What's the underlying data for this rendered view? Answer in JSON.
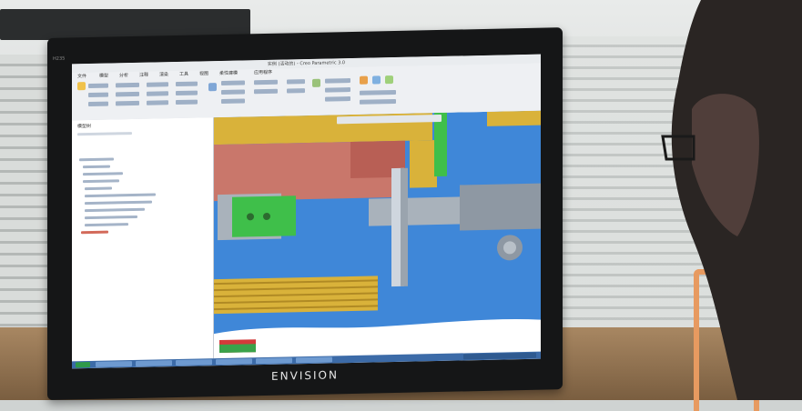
{
  "monitor": {
    "brand": "ENVISION",
    "model": "H235"
  },
  "app": {
    "title": "实例 (活动的) - Creo Parametric 3.0",
    "ribbon_tabs": [
      "文件",
      "模型",
      "分析",
      "注释",
      "渲染",
      "工具",
      "视图",
      "柔性建模",
      "应用程序"
    ],
    "tree_header": "模型树",
    "colors": {
      "part_blue": "#3f87d8",
      "part_gold": "#d9b23a",
      "part_salmon": "#c9776b",
      "part_green": "#3fbf4a",
      "part_gray": "#a9b2bb"
    }
  }
}
